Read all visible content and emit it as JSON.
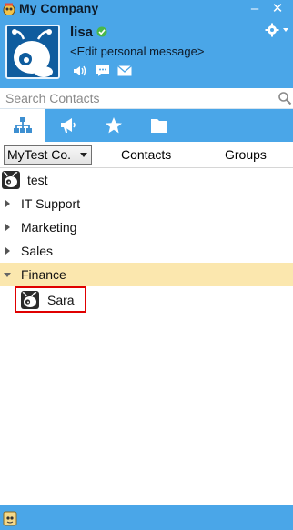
{
  "window": {
    "title": "My Company",
    "minimize_label": "–",
    "close_label": "✕"
  },
  "profile": {
    "username": "lisa",
    "personal_message": "<Edit personal message>",
    "status_icon": "online-check-icon",
    "tools": [
      "voice-icon",
      "chat-icon",
      "mail-icon"
    ]
  },
  "search": {
    "placeholder": "Search Contacts"
  },
  "tabs": [
    {
      "name": "organization",
      "icon": "org-chart-icon",
      "active": true
    },
    {
      "name": "broadcast",
      "icon": "megaphone-icon",
      "active": false
    },
    {
      "name": "favorites",
      "icon": "star-icon",
      "active": false
    },
    {
      "name": "files",
      "icon": "folder-icon",
      "active": false
    }
  ],
  "subheader": {
    "company_selected": "MyTest Co.",
    "contacts_label": "Contacts",
    "groups_label": "Groups"
  },
  "tree": {
    "root_user": "test",
    "groups": [
      {
        "label": "IT Support",
        "expanded": false
      },
      {
        "label": "Marketing",
        "expanded": false
      },
      {
        "label": "Sales",
        "expanded": false
      },
      {
        "label": "Finance",
        "expanded": true,
        "members": [
          "Sara"
        ]
      }
    ]
  },
  "colors": {
    "accent": "#4aa6e8",
    "selected_row": "#fbe7ae",
    "highlight_border": "#e00000"
  }
}
